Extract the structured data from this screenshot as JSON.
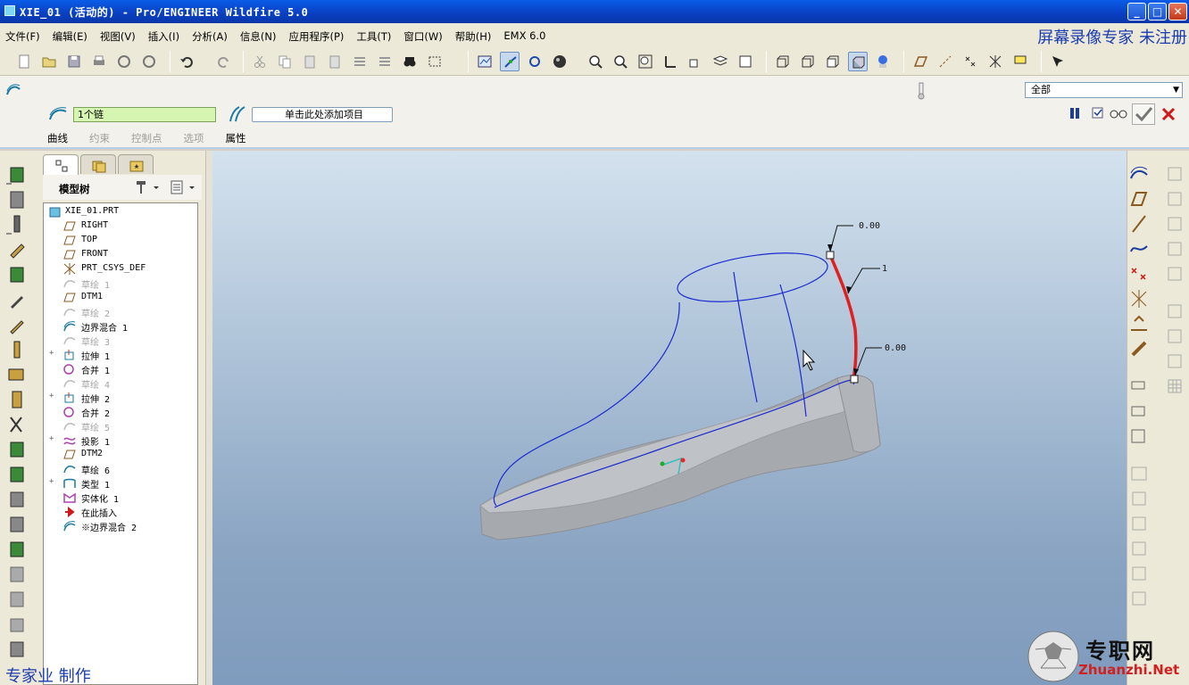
{
  "window": {
    "title": "XIE_01 (活动的) - Pro/ENGINEER Wildfire 5.0",
    "minimize_label": "_",
    "maximize_label": "□",
    "close_label": "✕"
  },
  "menu": {
    "items": [
      "文件(F)",
      "编辑(E)",
      "视图(V)",
      "插入(I)",
      "分析(A)",
      "信息(N)",
      "应用程序(P)",
      "工具(T)",
      "窗口(W)",
      "帮助(H)",
      "EMX 6.0"
    ],
    "watermark": "屏幕录像专家  未注册"
  },
  "dashboard": {
    "chain_field": "1个链",
    "add_item_field": "单击此处添加项目",
    "tabs": [
      "曲线",
      "约束",
      "控制点",
      "选项",
      "属性"
    ],
    "filter_value": "全部",
    "filter_arrow": "▼"
  },
  "model_tree": {
    "header": "模型树",
    "items": [
      {
        "label": "XIE_01.PRT",
        "icon": "part-icon",
        "expand": "",
        "dim": false
      },
      {
        "label": "RIGHT",
        "icon": "datum-plane-icon",
        "expand": "",
        "dim": false
      },
      {
        "label": "TOP",
        "icon": "datum-plane-icon",
        "expand": "",
        "dim": false
      },
      {
        "label": "FRONT",
        "icon": "datum-plane-icon",
        "expand": "",
        "dim": false
      },
      {
        "label": "PRT_CSYS_DEF",
        "icon": "csys-icon",
        "expand": "",
        "dim": false
      },
      {
        "label": "草绘 1",
        "icon": "sketch-icon",
        "expand": "",
        "dim": true
      },
      {
        "label": "DTM1",
        "icon": "datum-plane-icon",
        "expand": "",
        "dim": false
      },
      {
        "label": "草绘 2",
        "icon": "sketch-icon",
        "expand": "",
        "dim": true
      },
      {
        "label": "边界混合 1",
        "icon": "boundary-blend-icon",
        "expand": "",
        "dim": false
      },
      {
        "label": "草绘 3",
        "icon": "sketch-icon",
        "expand": "",
        "dim": true
      },
      {
        "label": "拉伸 1",
        "icon": "extrude-icon",
        "expand": "+",
        "dim": false
      },
      {
        "label": "合并 1",
        "icon": "merge-icon",
        "expand": "",
        "dim": false
      },
      {
        "label": "草绘 4",
        "icon": "sketch-icon",
        "expand": "",
        "dim": true
      },
      {
        "label": "拉伸 2",
        "icon": "extrude-icon",
        "expand": "+",
        "dim": false
      },
      {
        "label": "合并 2",
        "icon": "merge-icon",
        "expand": "",
        "dim": false
      },
      {
        "label": "草绘 5",
        "icon": "sketch-icon",
        "expand": "",
        "dim": true
      },
      {
        "label": "投影 1",
        "icon": "projection-icon",
        "expand": "+",
        "dim": false
      },
      {
        "label": "DTM2",
        "icon": "datum-plane-icon",
        "expand": "",
        "dim": false
      },
      {
        "label": "草绘 6",
        "icon": "sketch-icon",
        "expand": "",
        "dim": false
      },
      {
        "label": "类型 1",
        "icon": "type-icon",
        "expand": "+",
        "dim": false
      },
      {
        "label": "实体化 1",
        "icon": "solidify-icon",
        "expand": "",
        "dim": false
      },
      {
        "label": "在此插入",
        "icon": "insert-here-icon",
        "expand": "",
        "dim": false
      },
      {
        "label": "※边界混合 2",
        "icon": "boundary-blend-icon",
        "expand": "",
        "dim": false
      }
    ]
  },
  "viewport": {
    "dim_top": "0.00",
    "dim_mid": "1",
    "dim_bottom": "0.00"
  },
  "overlays": {
    "bottom_left": "专家业  制作",
    "brand_cn": "专职网",
    "brand_en": "Zhuanzhi.Net"
  },
  "colors": {
    "accent": "#0a3fc0",
    "selected_curve": "#e02020",
    "wireframe": "#1a2ad0",
    "chain_field": "#d6f5b0"
  }
}
